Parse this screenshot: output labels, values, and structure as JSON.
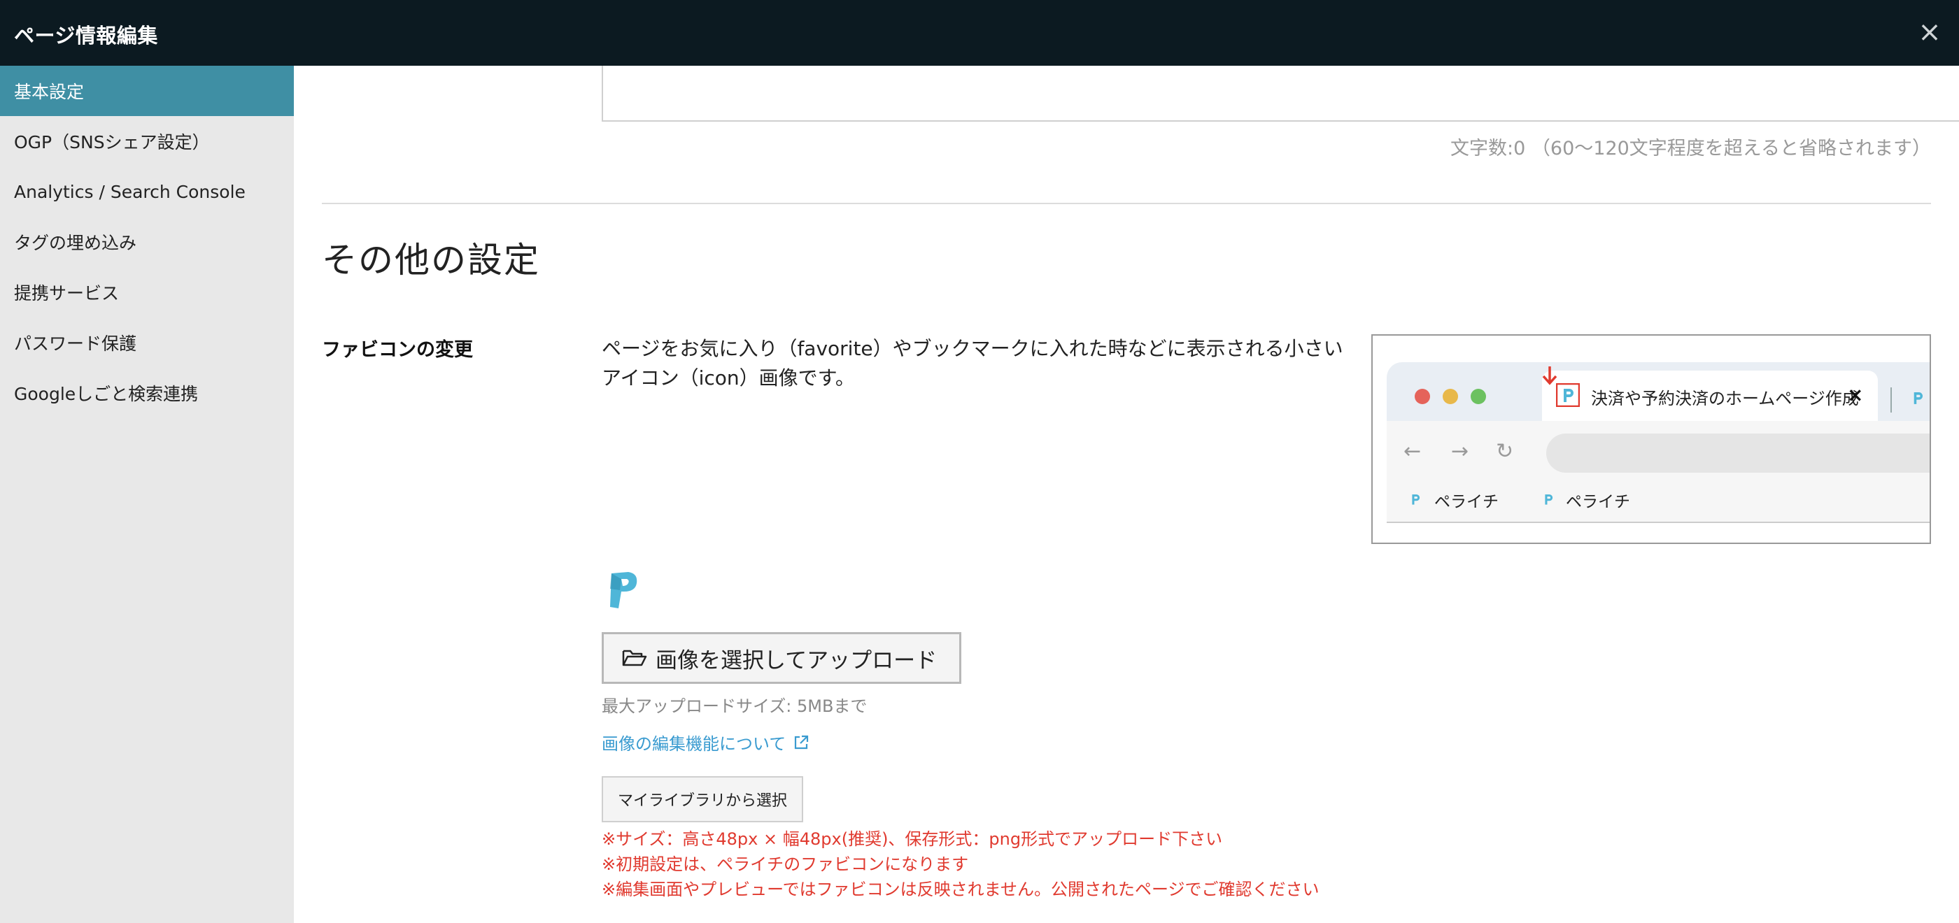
{
  "header": {
    "title": "ページ情報編集",
    "close_label": "×"
  },
  "sidebar": {
    "items": [
      {
        "label": "基本設定",
        "active": true
      },
      {
        "label": "OGP（SNSシェア設定）"
      },
      {
        "label": "Analytics / Search Console"
      },
      {
        "label": "タグの埋め込み"
      },
      {
        "label": "提携サービス"
      },
      {
        "label": "パスワード保護"
      },
      {
        "label": "Googleしごと検索連携"
      }
    ]
  },
  "description_field": {
    "char_count_text": "文字数:0 （60〜120文字程度を超えると省略されます）"
  },
  "section": {
    "title": "その他の設定"
  },
  "favicon": {
    "label": "ファビコンの変更",
    "description": "ページをお気に入り（favorite）やブックマークに入れた時などに表示される小さいアイコン（icon）画像です。",
    "illustration": {
      "tab_title": "決済や予約決済のホームページ作成",
      "tab_close": "×",
      "bookmarks": [
        "ペライチ",
        "ペライチ"
      ]
    },
    "upload_button": "画像を選択してアップロード",
    "max_size": "最大アップロードサイズ: 5MBまで",
    "edit_link": "画像の編集機能について",
    "library_button": "マイライブラリから選択",
    "notes": [
      "※サイズ：高さ48px × 幅48px(推奨)、保存形式：png形式でアップロード下さい",
      "※初期設定は、ペライチのファビコンになります",
      "※編集画面やプレビューではファビコンは反映されません。公開されたページでご確認ください"
    ]
  },
  "colors": {
    "header_bg": "#0c1a21",
    "sidebar_active": "#3f8fa4",
    "link": "#3a9bd0",
    "note_red": "#e03a2f",
    "brand_blue": "#4fb6d8"
  }
}
